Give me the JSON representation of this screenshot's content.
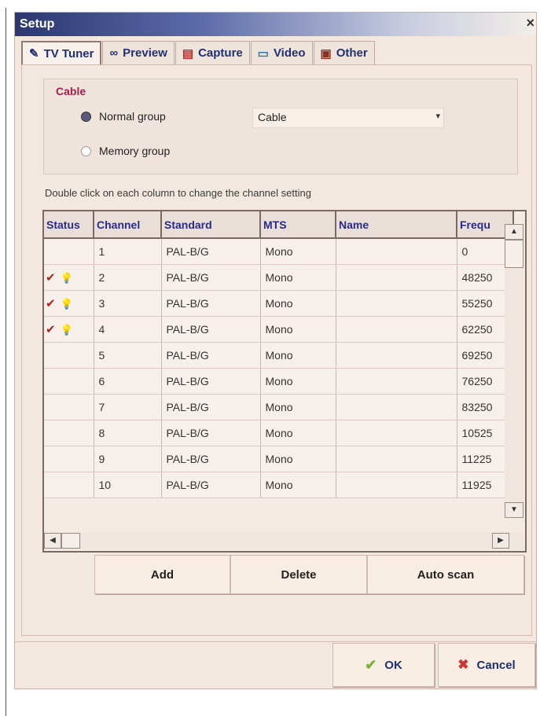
{
  "window": {
    "title": "Setup",
    "close": "×"
  },
  "tabs": [
    {
      "icon": "✎",
      "label": "TV Tuner"
    },
    {
      "icon": "∞",
      "label": "Preview"
    },
    {
      "icon": "▤",
      "label": "Capture"
    },
    {
      "icon": "▭",
      "label": "Video"
    },
    {
      "icon": "▣",
      "label": "Other"
    }
  ],
  "cable": {
    "label": "Cable",
    "normal_group": "Normal group",
    "memory_group": "Memory group",
    "select_value": "Cable",
    "select_arrow": "▾"
  },
  "hint": "Double click on each column to change the channel setting",
  "table": {
    "columns": [
      "Status",
      "Channel",
      "Standard",
      "MTS",
      "Name",
      "Frequ"
    ],
    "rows": [
      {
        "channel": "1",
        "standard": "PAL-B/G",
        "mts": "Mono",
        "name": "",
        "freq": "0"
      },
      {
        "channel": "2",
        "standard": "PAL-B/G",
        "mts": "Mono",
        "name": "",
        "freq": "48250",
        "check": "✔",
        "bulb": "💡"
      },
      {
        "channel": "3",
        "standard": "PAL-B/G",
        "mts": "Mono",
        "name": "",
        "freq": "55250",
        "check": "✔",
        "bulb": "💡"
      },
      {
        "channel": "4",
        "standard": "PAL-B/G",
        "mts": "Mono",
        "name": "",
        "freq": "62250",
        "check": "✔",
        "bulb": "💡"
      },
      {
        "channel": "5",
        "standard": "PAL-B/G",
        "mts": "Mono",
        "name": "",
        "freq": "69250"
      },
      {
        "channel": "6",
        "standard": "PAL-B/G",
        "mts": "Mono",
        "name": "",
        "freq": "76250"
      },
      {
        "channel": "7",
        "standard": "PAL-B/G",
        "mts": "Mono",
        "name": "",
        "freq": "83250"
      },
      {
        "channel": "8",
        "standard": "PAL-B/G",
        "mts": "Mono",
        "name": "",
        "freq": "10525"
      },
      {
        "channel": "9",
        "standard": "PAL-B/G",
        "mts": "Mono",
        "name": "",
        "freq": "11225"
      },
      {
        "channel": "10",
        "standard": "PAL-B/G",
        "mts": "Mono",
        "name": "",
        "freq": "11925"
      }
    ],
    "scroll_up": "▲",
    "scroll_down": "▼",
    "scroll_left": "◀",
    "scroll_right": "▶"
  },
  "buttons": {
    "add": "Add",
    "delete": "Delete",
    "auto_scan": "Auto scan"
  },
  "footer": {
    "ok": "OK",
    "ok_icon": "✔",
    "cancel": "Cancel",
    "cancel_icon": "✖"
  }
}
